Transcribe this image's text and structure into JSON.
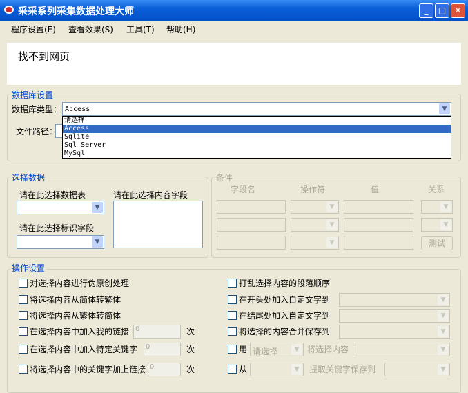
{
  "window": {
    "title": "采采系列采集数据处理大师",
    "minimize": "_",
    "maximize": "□",
    "close": "✕"
  },
  "menu": [
    "程序设置(E)",
    "查看效果(S)",
    "工具(T)",
    "帮助(H)"
  ],
  "web": {
    "heading": "找不到网页"
  },
  "db": {
    "group": "数据库设置",
    "type_label": "数据库类型：",
    "type_value": "Access",
    "path_label": "文件路径：",
    "options": [
      "请选择",
      "Access",
      "Sqlite",
      "Sql Server",
      "MySql"
    ],
    "selected_index": 1
  },
  "select": {
    "group": "选择数据",
    "table_label": "请在此选择数据表",
    "field_label": "请在此选择内容字段",
    "id_label": "请在此选择标识字段"
  },
  "cond": {
    "group": "条件",
    "headers": [
      "字段名",
      "操作符",
      "值",
      "关系"
    ],
    "test": "测试"
  },
  "ops": {
    "group": "操作设置",
    "left": [
      "对选择内容进行伪原创处理",
      "将选择内容从简体转繁体",
      "将选择内容从繁体转简体",
      "在选择内容中加入我的链接",
      "在选择内容中加入特定关键字",
      "将选择内容中的关键字加上链接"
    ],
    "right": [
      "打乱选择内容的段落顺序",
      "在开头处加入自定文字到",
      "在结尾处加入自定文字到",
      "将选择的内容合并保存到",
      "用",
      "从"
    ],
    "spin_value": "0",
    "times": "次",
    "use_select": "请选择",
    "use_mid": "将选择内容",
    "from_mid": "提取关键字保存到"
  }
}
